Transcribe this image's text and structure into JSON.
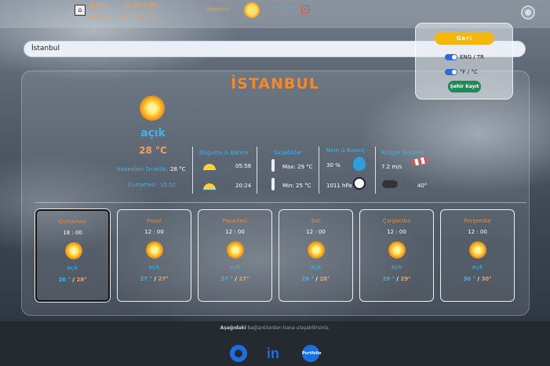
{
  "topbar": {
    "lat_label": "Enlem:",
    "lat_value": "41.0121231",
    "lon_label": "Boylam:",
    "lon_value": "28.9387836",
    "city_label": "İstanbul:",
    "temp": "28.73 °C",
    "delete_icon": "close-icon",
    "settings_icon": "gear-icon"
  },
  "search": {
    "value": "İstanbul"
  },
  "settings": {
    "back_label": "Geri",
    "lang_label": "ENG / TR",
    "unit_label": "°F / °C",
    "save_label": "Şehir Kayıt"
  },
  "current": {
    "city": "İSTANBUL",
    "condition": "açık",
    "temp": "28 °C",
    "feels_label": "Hissesilen Sıcaklık:",
    "feels_value": "28 °C",
    "day": "Cumartesi",
    "time": "15:52"
  },
  "sun": {
    "title": "Doğumu & Batımı",
    "rise": "05:56",
    "set": "20:24"
  },
  "temps": {
    "title": "Sıcaklıklar",
    "max": "Max: 29 °C",
    "min": "Min: 25 °C"
  },
  "humidity": {
    "title": "Nem & Basınç",
    "humidity": "30 %",
    "pressure": "1011 hPa"
  },
  "wind": {
    "title": "Rüzgar Durumu",
    "speed": "7.2 m/s",
    "deg": "40°"
  },
  "forecast": [
    {
      "day": "Cumartesi",
      "time": "18 : 00",
      "cond": "açık",
      "lo": "26 °",
      "hi": "28°"
    },
    {
      "day": "Pazar",
      "time": "12 : 00",
      "cond": "açık",
      "lo": "27 °",
      "hi": "27°"
    },
    {
      "day": "Pazartesi",
      "time": "12 : 00",
      "cond": "açık",
      "lo": "27 °",
      "hi": "27°"
    },
    {
      "day": "Salı",
      "time": "12 : 00",
      "cond": "açık",
      "lo": "28 °",
      "hi": "28°"
    },
    {
      "day": "Çarşamba",
      "time": "12 : 00",
      "cond": "açık",
      "lo": "29 °",
      "hi": "29°"
    },
    {
      "day": "Perşembe",
      "time": "12 : 00",
      "cond": "açık",
      "lo": "30 °",
      "hi": "30°"
    }
  ],
  "footer": {
    "text_bold": "Aşağıdaki",
    "text_rest": " bağlantılardan bana ulaşabilirsiniz.",
    "links": [
      "github-icon",
      "linkedin-icon",
      "portfolio-icon"
    ],
    "linkedin_text": "in",
    "portfolio_text": "Portfolio"
  }
}
